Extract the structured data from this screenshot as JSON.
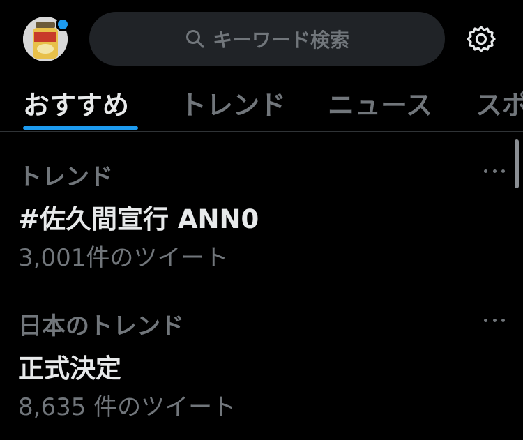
{
  "header": {
    "search": {
      "placeholder": "キーワード検索"
    }
  },
  "tabs": [
    {
      "label": "おすすめ",
      "active": true
    },
    {
      "label": "トレンド"
    },
    {
      "label": "ニュース"
    },
    {
      "label": "スポ"
    }
  ],
  "trends": [
    {
      "context": "トレンド",
      "title": "#佐久間宣行 ANN0",
      "count": "3,001件のツイート"
    },
    {
      "context": "日本のトレンド",
      "title": "正式決定",
      "count": "8,635 件のツイート"
    }
  ],
  "colors": {
    "accent": "#1d9bf0",
    "background": "#000000",
    "muted": "#71767b"
  }
}
